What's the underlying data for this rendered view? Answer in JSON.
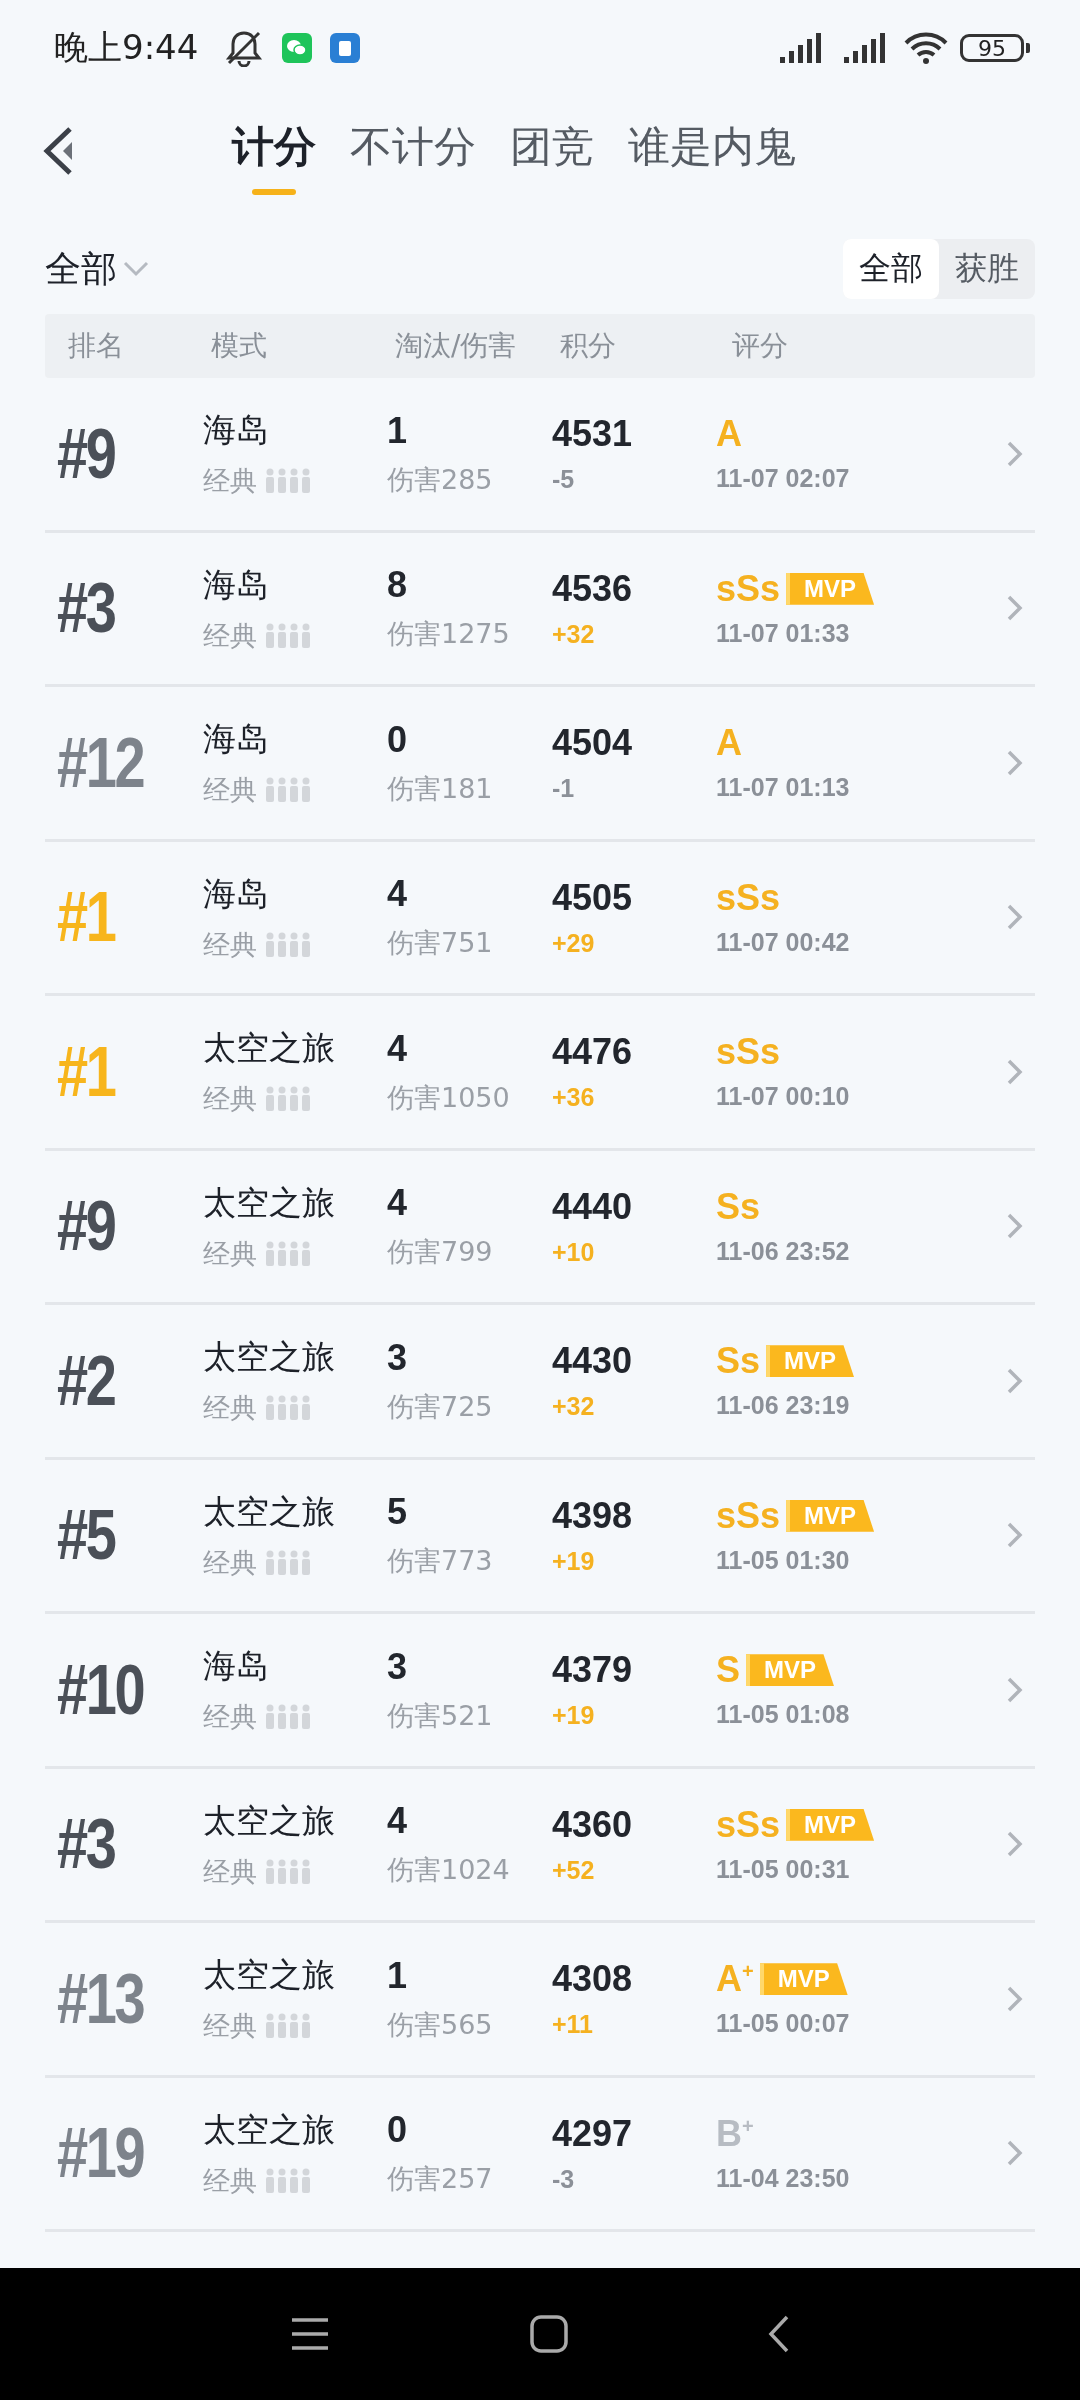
{
  "status_bar": {
    "time": "晚上9:44",
    "battery": "95"
  },
  "tabs": [
    {
      "label": "计分",
      "selected": true
    },
    {
      "label": "不计分",
      "selected": false
    },
    {
      "label": "团竞",
      "selected": false
    },
    {
      "label": "谁是内鬼",
      "selected": false
    }
  ],
  "filter": {
    "dropdown": "全部",
    "segments": [
      {
        "label": "全部",
        "selected": true
      },
      {
        "label": "获胜",
        "selected": false
      }
    ]
  },
  "table": {
    "columns": [
      "排名",
      "模式",
      "淘汰/伤害",
      "积分",
      "评分"
    ],
    "rows": [
      {
        "rank": {
          "text": "#9",
          "color": "#4b5058"
        },
        "map": "海岛",
        "mode": "经典",
        "kills": "1",
        "damage": "伤害285",
        "points": "4531",
        "delta": "-5",
        "gain": false,
        "grade": {
          "text": "A",
          "color": "#f5b120"
        },
        "time": "11-07 02:07"
      },
      {
        "rank": {
          "text": "#3",
          "color": "#4b5058"
        },
        "map": "海岛",
        "mode": "经典",
        "kills": "8",
        "damage": "伤害1275",
        "points": "4536",
        "delta": "+32",
        "gain": true,
        "grade": {
          "text": "sSs",
          "color": "#f5b120"
        },
        "badge": "MVP",
        "time": "11-07 01:33"
      },
      {
        "rank": {
          "text": "#12",
          "color": "#7d838b"
        },
        "map": "海岛",
        "mode": "经典",
        "kills": "0",
        "damage": "伤害181",
        "points": "4504",
        "delta": "-1",
        "gain": false,
        "grade": {
          "text": "A",
          "color": "#f5b120"
        },
        "time": "11-07 01:13"
      },
      {
        "rank": {
          "text": "#1",
          "color": "#f7b51c"
        },
        "map": "海岛",
        "mode": "经典",
        "kills": "4",
        "damage": "伤害751",
        "points": "4505",
        "delta": "+29",
        "gain": true,
        "grade": {
          "text": "sSs",
          "color": "#f5b120"
        },
        "time": "11-07 00:42"
      },
      {
        "rank": {
          "text": "#1",
          "color": "#f7b51c"
        },
        "map": "太空之旅",
        "mode": "经典",
        "kills": "4",
        "damage": "伤害1050",
        "points": "4476",
        "delta": "+36",
        "gain": true,
        "grade": {
          "text": "sSs",
          "color": "#f5b120"
        },
        "time": "11-07 00:10"
      },
      {
        "rank": {
          "text": "#9",
          "color": "#4b5058"
        },
        "map": "太空之旅",
        "mode": "经典",
        "kills": "4",
        "damage": "伤害799",
        "points": "4440",
        "delta": "+10",
        "gain": true,
        "grade": {
          "text": "Ss",
          "color": "#f5b120"
        },
        "time": "11-06 23:52"
      },
      {
        "rank": {
          "text": "#2",
          "color": "#4b5058"
        },
        "map": "太空之旅",
        "mode": "经典",
        "kills": "3",
        "damage": "伤害725",
        "points": "4430",
        "delta": "+32",
        "gain": true,
        "grade": {
          "text": "Ss",
          "color": "#f5b120"
        },
        "badge": "MVP",
        "time": "11-06 23:19"
      },
      {
        "rank": {
          "text": "#5",
          "color": "#4b5058"
        },
        "map": "太空之旅",
        "mode": "经典",
        "kills": "5",
        "damage": "伤害773",
        "points": "4398",
        "delta": "+19",
        "gain": true,
        "grade": {
          "text": "sSs",
          "color": "#f5b120"
        },
        "badge": "MVP",
        "time": "11-05 01:30"
      },
      {
        "rank": {
          "text": "#10",
          "color": "#4b5058"
        },
        "map": "海岛",
        "mode": "经典",
        "kills": "3",
        "damage": "伤害521",
        "points": "4379",
        "delta": "+19",
        "gain": true,
        "grade": {
          "text": "S",
          "color": "#f5b120"
        },
        "badge": "MVP",
        "time": "11-05 01:08"
      },
      {
        "rank": {
          "text": "#3",
          "color": "#4b5058"
        },
        "map": "太空之旅",
        "mode": "经典",
        "kills": "4",
        "damage": "伤害1024",
        "points": "4360",
        "delta": "+52",
        "gain": true,
        "grade": {
          "text": "sSs",
          "color": "#f5b120"
        },
        "badge": "MVP",
        "time": "11-05 00:31"
      },
      {
        "rank": {
          "text": "#13",
          "color": "#7d838b"
        },
        "map": "太空之旅",
        "mode": "经典",
        "kills": "1",
        "damage": "伤害565",
        "points": "4308",
        "delta": "+11",
        "gain": true,
        "grade": {
          "text": "A$^{+}$",
          "color": "#f5b120"
        },
        "badge": "MVP",
        "time": "11-05 00:07"
      },
      {
        "rank": {
          "text": "#19",
          "color": "#7d838b"
        },
        "map": "太空之旅",
        "mode": "经典",
        "kills": "0",
        "damage": "伤害257",
        "points": "4297",
        "delta": "-3",
        "gain": false,
        "grade": {
          "text": "B$^{+}$",
          "color": "#b7bcc3"
        },
        "time": "11-04 23:50"
      }
    ]
  }
}
